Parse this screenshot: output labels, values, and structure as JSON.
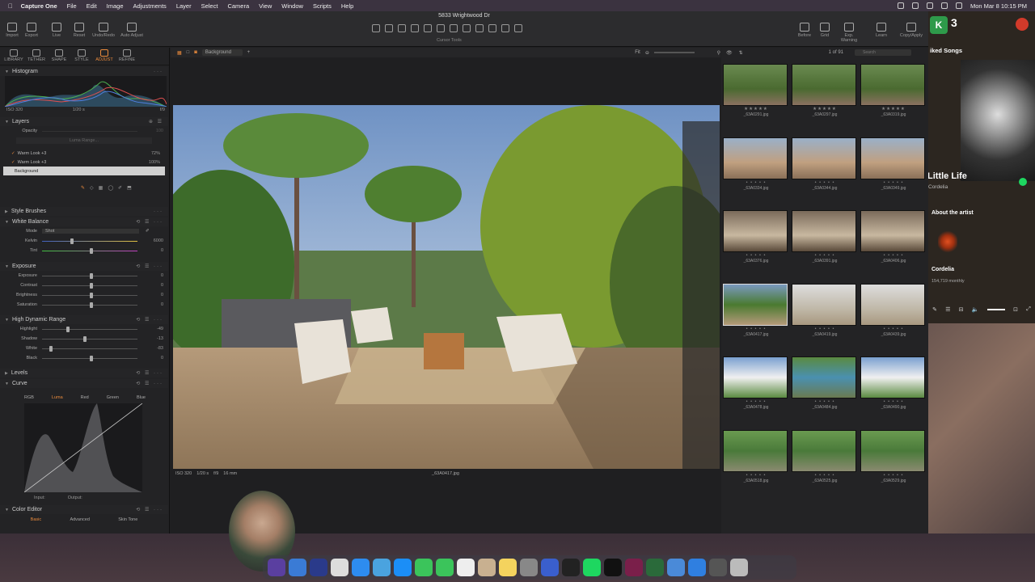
{
  "menubar": {
    "app": "Capture One",
    "items": [
      "File",
      "Edit",
      "Image",
      "Adjustments",
      "Layer",
      "Select",
      "Camera",
      "View",
      "Window",
      "Scripts",
      "Help"
    ],
    "datetime": "Mon Mar 8  10:15 PM"
  },
  "window": {
    "title": "5833 Wrightwood Dr"
  },
  "toolbar": {
    "left": [
      "Import",
      "Export",
      "Live",
      "Reset",
      "Undo/Redo",
      "Auto Adjust"
    ],
    "cursor_tools_label": "Cursor Tools",
    "right": [
      "Before",
      "Grid",
      "Exp. Warning",
      "Learn",
      "Copy/Apply"
    ]
  },
  "tool_tabs": [
    "LIBRARY",
    "TETHER",
    "SHAPE",
    "STYLE",
    "ADJUST",
    "REFINE"
  ],
  "histogram": {
    "title": "Histogram",
    "iso": "ISO 320",
    "shutter": "1/20 s",
    "aperture": "f/9"
  },
  "layers": {
    "title": "Layers",
    "opacity_label": "Opacity",
    "opacity_val": "100",
    "luma_range": "Luma Range...",
    "items": [
      {
        "name": "Warm Look +3",
        "pct": "72%"
      },
      {
        "name": "Warm Look +3",
        "pct": "100%"
      },
      {
        "name": "Background",
        "pct": ""
      }
    ]
  },
  "style_brushes": "Style Brushes",
  "white_balance": {
    "title": "White Balance",
    "mode_label": "Mode",
    "mode": "Shot",
    "rows": [
      {
        "label": "Kelvin",
        "val": "6000",
        "pos": 0.3
      },
      {
        "label": "Tint",
        "val": "0",
        "pos": 0.5
      }
    ]
  },
  "exposure": {
    "title": "Exposure",
    "rows": [
      {
        "label": "Exposure",
        "val": "0",
        "pos": 0.5
      },
      {
        "label": "Contrast",
        "val": "0",
        "pos": 0.5
      },
      {
        "label": "Brightness",
        "val": "0",
        "pos": 0.5
      },
      {
        "label": "Saturation",
        "val": "0",
        "pos": 0.5
      }
    ]
  },
  "hdr": {
    "title": "High Dynamic Range",
    "rows": [
      {
        "label": "Highlight",
        "val": "-49",
        "pos": 0.25
      },
      {
        "label": "Shadow",
        "val": "-13",
        "pos": 0.43
      },
      {
        "label": "White",
        "val": "-83",
        "pos": 0.08
      },
      {
        "label": "Black",
        "val": "0",
        "pos": 0.5
      }
    ]
  },
  "levels": "Levels",
  "curve": {
    "title": "Curve",
    "tabs": [
      "RGB",
      "Luma",
      "Red",
      "Green",
      "Blue"
    ],
    "input_label": "Input:",
    "output_label": "Output:"
  },
  "color_editor": {
    "title": "Color Editor",
    "tabs": [
      "Basic",
      "Advanced",
      "Skin Tone"
    ]
  },
  "viewer": {
    "variant": "Background",
    "fit": "Fit",
    "info": [
      "ISO 320",
      "1/20 s",
      "f/9",
      "16 mm"
    ],
    "filename": "_63A0417.jpg"
  },
  "browser": {
    "count": "1 of 91",
    "search_placeholder": "Search",
    "thumbs": [
      {
        "name": "_63A0291.jpg",
        "scene": "garden"
      },
      {
        "name": "_63A0297.jpg",
        "scene": "garden"
      },
      {
        "name": "_63A0319.jpg",
        "scene": "garden"
      },
      {
        "name": "_63A0334.jpg",
        "scene": "patio"
      },
      {
        "name": "_63A0344.jpg",
        "scene": "patio"
      },
      {
        "name": "_63A0349.jpg",
        "scene": "patio"
      },
      {
        "name": "_63A0376.jpg",
        "scene": "living"
      },
      {
        "name": "_63A0391.jpg",
        "scene": "living"
      },
      {
        "name": "_63A0406.jpg",
        "scene": "living"
      },
      {
        "name": "_63A0417.jpg",
        "scene": "deck"
      },
      {
        "name": "_63A0419.jpg",
        "scene": "interior"
      },
      {
        "name": "_63A0439.jpg",
        "scene": "interior"
      },
      {
        "name": "_63A0478.jpg",
        "scene": "house"
      },
      {
        "name": "_63A0484.jpg",
        "scene": "pool"
      },
      {
        "name": "_63A0490.jpg",
        "scene": "house"
      },
      {
        "name": "_63A0518.jpg",
        "scene": "aerial"
      },
      {
        "name": "_63A0525.jpg",
        "scene": "aerial"
      },
      {
        "name": "_63A0529.jpg",
        "scene": "aerial"
      }
    ]
  },
  "spotify": {
    "header": "iked Songs",
    "track": "Little Life",
    "artist": "Cordelia",
    "about": "About the artist",
    "artist_name": "Cordelia",
    "listeners": "154,719 monthly"
  },
  "colors": {
    "accent": "#e98a3c"
  }
}
